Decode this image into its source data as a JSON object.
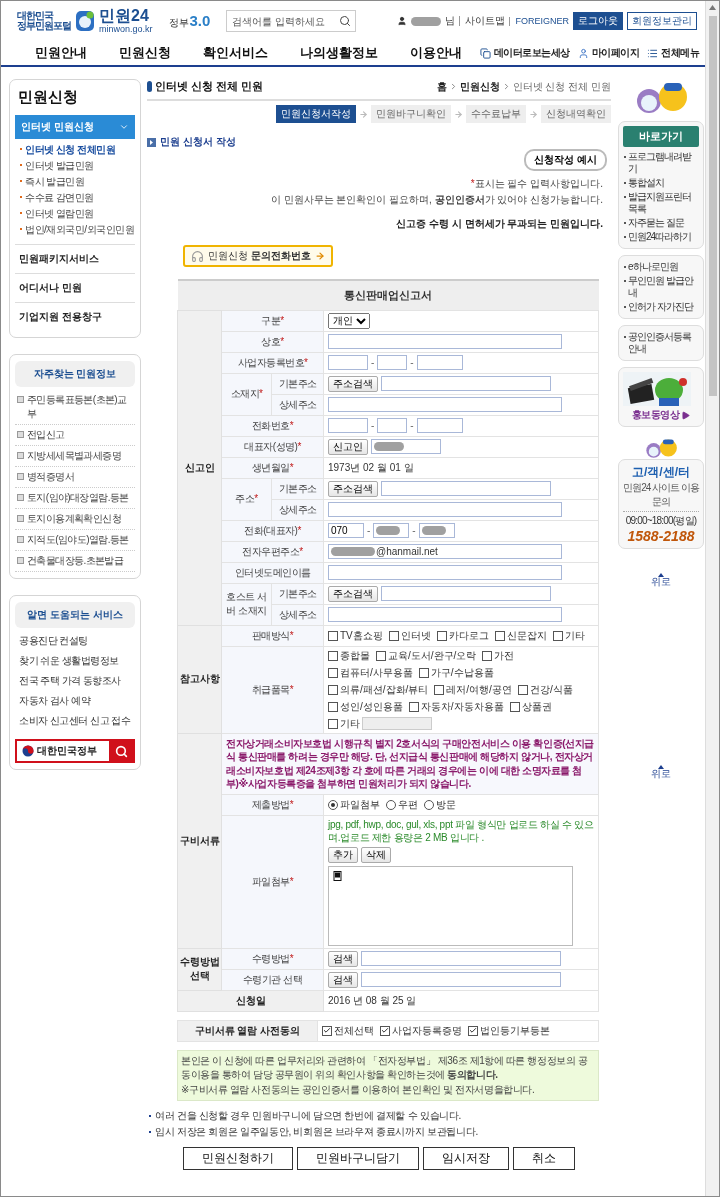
{
  "header": {
    "logo": {
      "tagline": [
        "대한민국",
        "정부민원포털"
      ],
      "name": "민원24",
      "domain": "minwon.go.kr"
    },
    "gov_logo": {
      "text": "정부",
      "version": "3.0"
    },
    "search": {
      "placeholder": "검색어를 입력하세요"
    },
    "user": {
      "redacted": true,
      "suffix": "님"
    },
    "links": [
      "사이트맵",
      "FOREIGNER"
    ],
    "buttons": [
      "로그아웃",
      "회원정보관리"
    ]
  },
  "nav": {
    "items": [
      "민원안내",
      "민원신청",
      "확인서비스",
      "나의생활정보",
      "이용안내"
    ],
    "utilities": [
      {
        "label": "데이터로보는세상",
        "kind": "data"
      },
      {
        "label": "마이페이지",
        "kind": "person"
      },
      {
        "label": "전체메뉴",
        "kind": "menu"
      }
    ]
  },
  "sidebar": {
    "title": "민원신청",
    "sections": [
      {
        "label": "인터넷 민원신청",
        "expanded": true,
        "children": [
          {
            "label": "인터넷 신청 전체민원",
            "selected": true
          },
          {
            "label": "인터넷 발급민원",
            "selected": false
          },
          {
            "label": "즉시 발급민원",
            "selected": false
          },
          {
            "label": "수수료 감면민원",
            "selected": false
          },
          {
            "label": "인터넷 열람민원",
            "selected": false
          },
          {
            "label": "법인/재외국민/외국인민원",
            "selected": false
          }
        ]
      },
      {
        "label": "민원패키지서비스",
        "expanded": false
      },
      {
        "label": "어디서나 민원",
        "expanded": false
      },
      {
        "label": "기업지원 전용창구",
        "expanded": false
      }
    ]
  },
  "frequent": {
    "title": "자주찾는 민원정보",
    "items": [
      "주민등록표등본(초본)교부",
      "전입신고",
      "지방세세목별과세증명",
      "병적증명서",
      "토지(임야)대장열람.등본",
      "토지이용계획확인신청",
      "지적도(임야도)열람.등본",
      "건축물대장등.초본발급"
    ]
  },
  "services": {
    "title": "알면 도움되는 서비스",
    "items": [
      "공용진단 컨설팅",
      "찾기 쉬운 생활법령정보",
      "전국 주택 가격 동향조사",
      "자동차 검사 예약",
      "소비자 신고센터 신고 접수"
    ],
    "gov_search": "대한민국정부"
  },
  "page": {
    "title": "인터넷 신청 전체 민원",
    "breadcrumb": [
      "홈",
      "민원신청",
      "인터넷 신청 전체 민원"
    ],
    "steps": [
      {
        "label": "민원신청서작성",
        "selected": true
      },
      {
        "label": "민원바구니확인",
        "selected": false
      },
      {
        "label": "수수료납부",
        "selected": false
      },
      {
        "label": "신청내역확인",
        "selected": false
      }
    ],
    "section_title": "민원 신청서 작성",
    "example_button": "신청작성 예시",
    "required_note": {
      "mark": "*",
      "text": "표시는 필수 입력사항입니다."
    },
    "cert_note": "이 민원사무는 본인확인이 필요하며, **공인인증서**가 있어야 신청가능합니다.",
    "tax_note": "신고증 수령 시 면허세가 무과되는 민원입니다.",
    "inquiry_button": "민원신청 **문의전화번호**"
  },
  "form": {
    "title": "통신판매업신고서",
    "groups": [
      {
        "label": "신고인",
        "rows": [
          {
            "label": "구분",
            "mark": "*",
            "kind": "select",
            "value": "개인"
          },
          {
            "label": "상호",
            "mark": "*",
            "kind": "text"
          },
          {
            "label": "사업자등록번호",
            "mark": "*",
            "kind": "triple",
            "separators": [
              "-",
              "-"
            ]
          },
          {
            "label": "소재지",
            "mark": "*",
            "sub": [
              {
                "label": "기본주소",
                "kind": "address",
                "button": "주소검색"
              },
              {
                "label": "상세주소",
                "kind": "text"
              }
            ]
          },
          {
            "label": "전화번호",
            "mark": "*",
            "kind": "triple",
            "separators": [
              "-",
              "-"
            ]
          },
          {
            "label": "대표자(성명)",
            "mark": "*",
            "kind": "person",
            "button": "신고인"
          },
          {
            "label": "생년월일",
            "mark": "*",
            "kind": "date",
            "value": "1973년 02 월 01 일"
          },
          {
            "label": "주소",
            "mark": "*",
            "sub": [
              {
                "label": "기본주소",
                "kind": "address",
                "button": "주소검색"
              },
              {
                "label": "상세주소",
                "kind": "text"
              }
            ]
          },
          {
            "label": "전화(대표자)",
            "mark": "*",
            "kind": "phone",
            "parts": [
              {
                "value": "070"
              },
              {
                "redacted": true
              },
              {
                "redacted": true
              }
            ],
            "separators": [
              "-",
              "-"
            ]
          },
          {
            "label": "전자우편주소",
            "mark": "*",
            "kind": "email",
            "redacted": true,
            "value": "@hanmail.net"
          },
          {
            "label": "인터넷도메인이름",
            "kind": "text"
          },
          {
            "label": "호스트 서버 소재지",
            "sub": [
              {
                "label": "기본주소",
                "kind": "address",
                "button": "주소검색"
              },
              {
                "label": "상세주소",
                "kind": "text"
              }
            ]
          }
        ]
      },
      {
        "label": "참고사항",
        "rows": [
          {
            "label": "판매방식",
            "mark": "*",
            "kind": "checks",
            "options": [
              {
                "label": "TV홈쇼핑",
                "checked": false
              },
              {
                "label": "인터넷",
                "checked": false
              },
              {
                "label": "카다로그",
                "checked": false
              },
              {
                "label": "신문잡지",
                "checked": false
              },
              {
                "label": "기타",
                "checked": false
              }
            ]
          },
          {
            "label": "취급품목",
            "mark": "*",
            "kind": "checks",
            "options": [
              {
                "label": "종합몰",
                "checked": false
              },
              {
                "label": "교육/도서/완구/오락",
                "checked": false
              },
              {
                "label": "가전",
                "checked": false
              },
              {
                "label": "컴퓨터/사무용품",
                "checked": false
              },
              {
                "label": "가구/수납용품",
                "checked": false
              },
              {
                "label": "의류/패션/잡화/뷰티",
                "checked": false
              },
              {
                "label": "레저/여행/공연",
                "checked": false
              },
              {
                "label": "건강/식품",
                "checked": false
              },
              {
                "label": "성인/성인용품",
                "checked": false
              },
              {
                "label": "자동차/자동차용품",
                "checked": false
              },
              {
                "label": "상품권",
                "checked": false
              },
              {
                "label": "기타",
                "checked": false,
                "field_disabled": true
              }
            ]
          }
        ]
      },
      {
        "label": "구비서류",
        "rows": [
          {
            "kind": "notice",
            "text": "전자상거래소비자보호법 시행규칙 별지 2호서식의 구매안전서비스 이용 확인증(선지급식 통신판매를 하려는 경우만 해당. 단, 선지급식 통신판매에 해당하지 않거나, 전자상거래소비자보호법 제24조제3항 각 호에 따른 거래의 경우에는 이에 대한 소명자료를 첨부)※사업자등록증을 첨부하면 민원처리가 되지 않습니다."
          },
          {
            "label": "제출방법",
            "mark": "*",
            "kind": "radios",
            "options": [
              {
                "label": "파일첨부",
                "selected": true
              },
              {
                "label": "우편",
                "selected": false
              },
              {
                "label": "방문",
                "selected": false
              }
            ]
          },
          {
            "label": "파일첨부",
            "mark": "*",
            "kind": "upload",
            "note": "jpg, pdf, hwp, doc, gul, xls, ppt 파일 형식만 업로드 하실 수 있으며.업로드 제한 용량은 2 MB 입니다 .",
            "buttons": [
              "추가",
              "삭제"
            ]
          }
        ]
      },
      {
        "label": "수령방법 선택",
        "rows": [
          {
            "label": "수령방법",
            "mark": "*",
            "kind": "search",
            "button": "검색"
          },
          {
            "label": "수령기관 선택",
            "kind": "search",
            "button": "검색"
          }
        ]
      }
    ],
    "date_row": {
      "label": "신청일",
      "value": "2016 년 08 월 25 일"
    }
  },
  "consent": {
    "label": "구비서류 열람 사전동의",
    "options": [
      {
        "label": "전체선택",
        "checked": true
      },
      {
        "label": "사업자등록증명",
        "checked": true
      },
      {
        "label": "법인등기부등본",
        "checked": true
      }
    ]
  },
  "agreement": [
    "본인은 이 신청에 따른 업무처리와 관련하여 「전자정부법」 제36조 제1항에 따른 행정정보의 공동이용을 통하여 담당 공무원이 위의 확인사항을 확인하는것에 **동의합니다.**",
    "※구비서류 열람 사전동의는 공인인증서를 이용하여 본인확인 및 전자서명을합니다."
  ],
  "tips": [
    "여러 건을 신청할 경우 민원바구니에 담으면 한번에 결제할 수 있습니다.",
    "임시 저장은 회원은 일주일동안, 비회원은 브라우져 종료시까지 보관됩니다."
  ],
  "actions": [
    "민원신청하기",
    "민원바구니담기",
    "임시저장",
    "취소"
  ],
  "quickbar": {
    "shortcut_title": "바로가기",
    "shortcuts": [
      "프로그램내려받기",
      "통합설치",
      "발급지원프린터목록",
      "자주묻는 질문",
      "민원24따라하기"
    ],
    "services": [
      "e하나로민원",
      "무인민원 발급안내",
      "인허가 자가진단"
    ],
    "cert": [
      "공인인증서등록안내"
    ],
    "video": "홍보동영상",
    "center": {
      "title": "고/객/센/터",
      "subtitle": "민원24 사이트 이용문의",
      "hours": "09:00~18:00(평일)",
      "phone": "1588-2188"
    },
    "top_links": [
      "위로",
      "위로"
    ]
  }
}
